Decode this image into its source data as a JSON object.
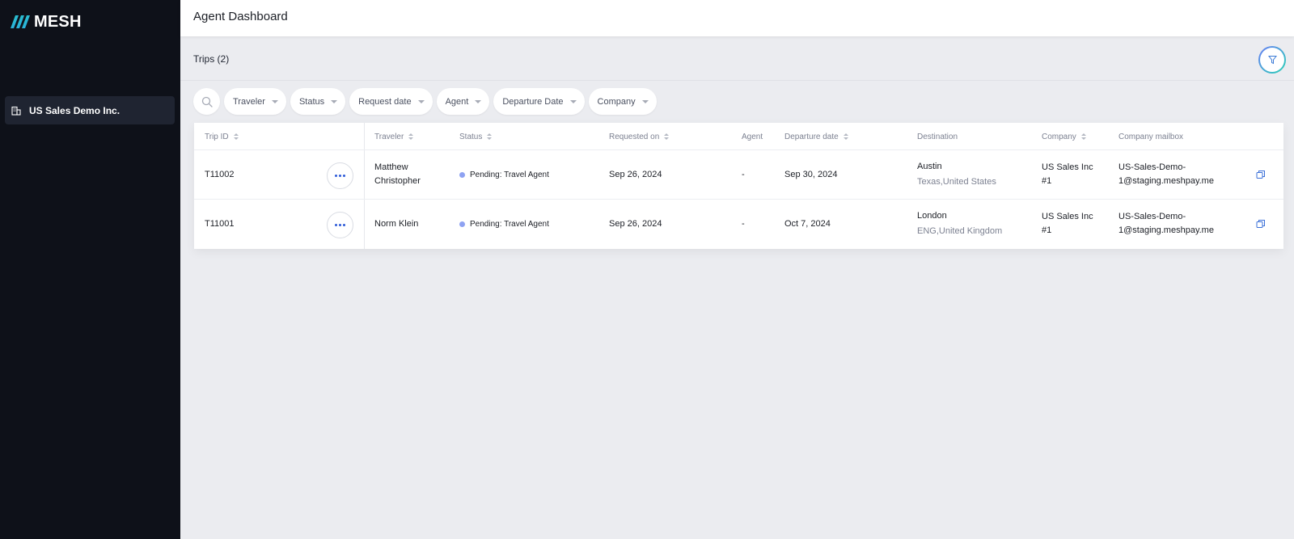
{
  "brand": {
    "name": "MESH"
  },
  "sidebar": {
    "org": {
      "label": "US Sales Demo Inc.",
      "icon": "building-icon"
    }
  },
  "header": {
    "title": "Agent Dashboard"
  },
  "trips": {
    "title": "Trips (2)",
    "filter_icon": "filter-icon"
  },
  "filters": [
    {
      "label": "Traveler"
    },
    {
      "label": "Status"
    },
    {
      "label": "Request date"
    },
    {
      "label": "Agent"
    },
    {
      "label": "Departure Date"
    },
    {
      "label": "Company"
    }
  ],
  "table": {
    "columns": [
      {
        "label": "Trip ID"
      },
      {
        "label": "Traveler"
      },
      {
        "label": "Status"
      },
      {
        "label": "Requested on"
      },
      {
        "label": "Agent"
      },
      {
        "label": "Departure date"
      },
      {
        "label": "Destination"
      },
      {
        "label": "Company"
      },
      {
        "label": "Company mailbox"
      }
    ],
    "rows": [
      {
        "trip_id": "T11002",
        "traveler_line1": "Matthew",
        "traveler_line2": "Christopher",
        "status": "Pending: Travel Agent",
        "requested_on": "Sep 26, 2024",
        "agent": "-",
        "departure_date": "Sep 30, 2024",
        "destination_city": "Austin",
        "destination_region": "Texas,United States",
        "company_line1": "US Sales Inc",
        "company_line2": "#1",
        "mailbox_line1": "US-Sales-Demo-",
        "mailbox_line2": "1@staging.meshpay.me"
      },
      {
        "trip_id": "T11001",
        "traveler_line1": "Norm Klein",
        "traveler_line2": "",
        "status": "Pending: Travel Agent",
        "requested_on": "Sep 26, 2024",
        "agent": "-",
        "departure_date": "Oct 7, 2024",
        "destination_city": "London",
        "destination_region": "ENG,United Kingdom",
        "company_line1": "US Sales Inc",
        "company_line2": "#1",
        "mailbox_line1": "US-Sales-Demo-",
        "mailbox_line2": "1@staging.meshpay.me"
      }
    ]
  },
  "colors": {
    "sidebar_bg": "#0e1119",
    "accent": "#2e5bd8",
    "status_pending": "#8ea2f2",
    "logo_gradient_start": "#2ad2b6",
    "logo_gradient_end": "#2a9df4"
  }
}
